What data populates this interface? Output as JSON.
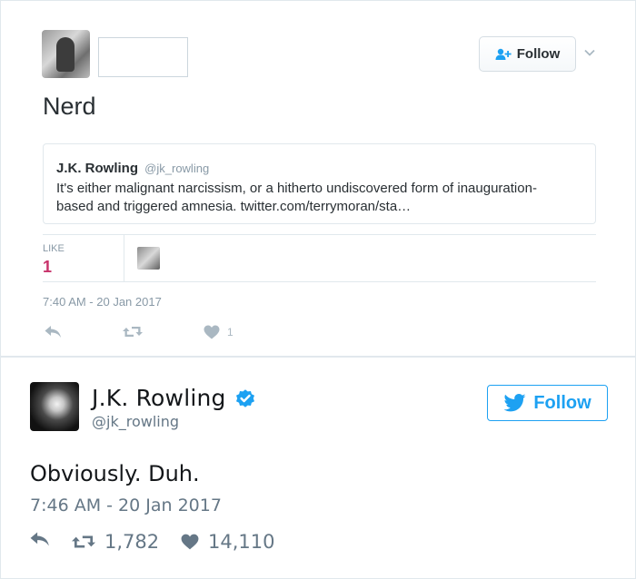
{
  "tweet1": {
    "follow_label": "Follow",
    "text": "Nerd",
    "quote": {
      "name": "J.K. Rowling",
      "handle": "@jk_rowling",
      "text": "It's either malignant narcissism, or a hitherto undiscovered form of inauguration-based and triggered amnesia. twitter.com/terrymoran/sta…"
    },
    "likes_label": "LIKE",
    "likes_count": "1",
    "timestamp": "7:40 AM - 20 Jan 2017",
    "action_like_count": "1"
  },
  "tweet2": {
    "name": "J.K. Rowling",
    "handle": "@jk_rowling",
    "follow_label": "Follow",
    "text": "Obviously. Duh.",
    "timestamp": "7:46 AM - 20 Jan 2017",
    "retweets": "1,782",
    "likes": "14,110"
  },
  "icons": [
    "add-user-icon",
    "chevron-down-icon",
    "reply-icon",
    "retweet-icon",
    "heart-icon",
    "verified-badge-icon",
    "twitter-bird-icon"
  ],
  "colors": {
    "twitter_blue": "#1da1f2",
    "like_pink": "#c8336b",
    "muted_gray": "#8899a6"
  }
}
